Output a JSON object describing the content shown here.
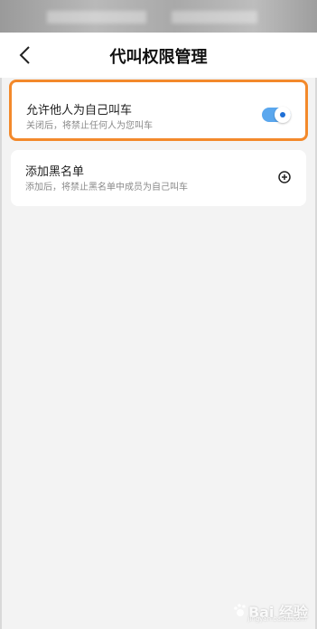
{
  "nav": {
    "title": "代叫权限管理",
    "back_icon": "chevron-left-icon"
  },
  "settings": {
    "allow_others": {
      "title": "允许他人为自己叫车",
      "subtitle": "关闭后，将禁止任何人为您叫车",
      "enabled": true
    },
    "blacklist": {
      "title": "添加黑名单",
      "subtitle": "添加后，将禁止黑名单中成员为自己叫车",
      "action_icon": "add-circle-icon"
    }
  },
  "colors": {
    "highlight_border": "#f3892b",
    "toggle_on": "#5aa7ee"
  },
  "watermark": {
    "logo_text": "Bai  经验",
    "sub_text": "jingyan.baidu.com"
  }
}
